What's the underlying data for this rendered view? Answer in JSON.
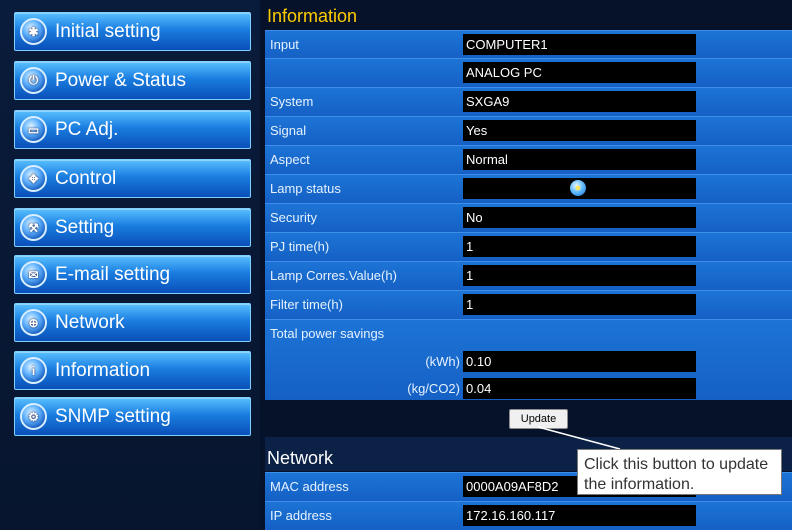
{
  "sidebar": {
    "items": [
      {
        "label": "Initial setting",
        "icon": "tools-icon"
      },
      {
        "label": "Power & Status",
        "icon": "power-icon"
      },
      {
        "label": "PC Adj.",
        "icon": "monitor-icon"
      },
      {
        "label": "Control",
        "icon": "control-icon"
      },
      {
        "label": "Setting",
        "icon": "wrench-icon"
      },
      {
        "label": "E-mail setting",
        "icon": "envelope-icon"
      },
      {
        "label": "Network",
        "icon": "network-icon"
      },
      {
        "label": "Information",
        "icon": "info-icon"
      },
      {
        "label": "SNMP setting",
        "icon": "snmp-icon"
      }
    ]
  },
  "information": {
    "title": "Information",
    "rows": [
      {
        "label": "Input",
        "value": "COMPUTER1"
      },
      {
        "label": "",
        "value": "ANALOG PC"
      },
      {
        "label": "System",
        "value": "SXGA9"
      },
      {
        "label": "Signal",
        "value": "Yes"
      },
      {
        "label": "Aspect",
        "value": "Normal"
      },
      {
        "label": "Lamp status",
        "value": ""
      },
      {
        "label": "Security",
        "value": "No"
      },
      {
        "label": "PJ time(h)",
        "value": "1"
      },
      {
        "label": "Lamp Corres.Value(h)",
        "value": "1"
      },
      {
        "label": "Filter time(h)",
        "value": "1"
      },
      {
        "label": "Total power savings",
        "value": ""
      },
      {
        "label": "(kWh)",
        "value": "0.10"
      },
      {
        "label": "(kg/CO2)",
        "value": "0.04"
      }
    ],
    "lamp_icon": "lamp-bulb-icon",
    "update_label": "Update"
  },
  "network": {
    "title": "Network",
    "rows": [
      {
        "label": "MAC address",
        "value": "0000A09AF8D2"
      },
      {
        "label": "IP address",
        "value": "172.16.160.117"
      }
    ]
  },
  "callout": {
    "text": "Click this button to update the information."
  },
  "colors": {
    "accent_title": "#ffcc00",
    "row_blue": "#1d74d6",
    "value_bg": "#000000"
  }
}
